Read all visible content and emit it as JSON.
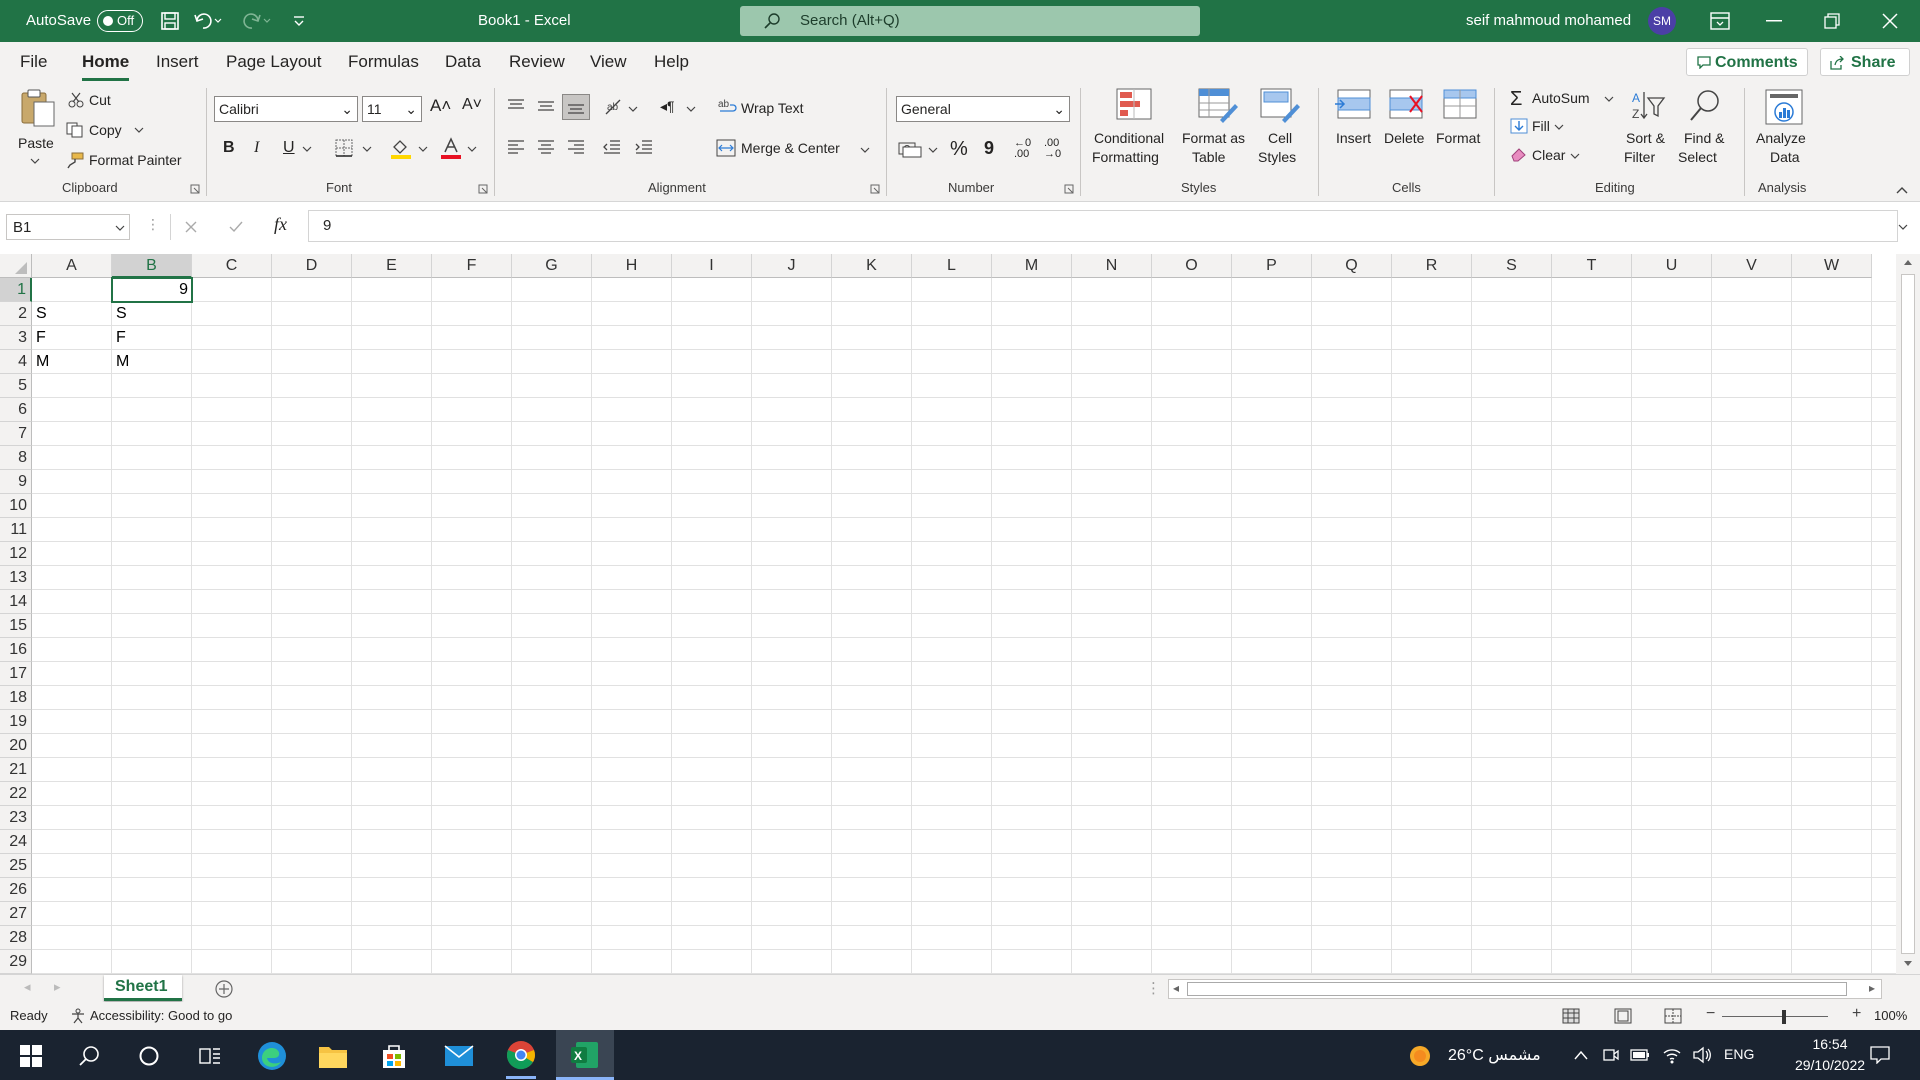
{
  "titlebar": {
    "autosave_label": "AutoSave",
    "autosave_state": "Off",
    "doc_title": "Book1  -  Excel",
    "search_placeholder": "Search (Alt+Q)",
    "user_name": "seif mahmoud mohamed",
    "user_initials": "SM",
    "accent": "#217346"
  },
  "tabs": [
    "File",
    "Home",
    "Insert",
    "Page Layout",
    "Formulas",
    "Data",
    "Review",
    "View",
    "Help"
  ],
  "active_tab": "Home",
  "tab_actions": {
    "comments": "Comments",
    "share": "Share"
  },
  "ribbon": {
    "clipboard": {
      "paste": "Paste",
      "cut": "Cut",
      "copy": "Copy",
      "format_painter": "Format Painter",
      "group": "Clipboard"
    },
    "font": {
      "family": "Calibri",
      "size": "11",
      "bold": "B",
      "italic": "I",
      "underline": "U",
      "group": "Font"
    },
    "alignment": {
      "wrap_text": "Wrap Text",
      "merge_center": "Merge & Center",
      "group": "Alignment"
    },
    "number": {
      "format": "General",
      "percent": "%",
      "comma": "9",
      "group": "Number"
    },
    "styles": {
      "conditional": "Conditional",
      "conditional2": "Formatting",
      "format_as": "Format as",
      "format_as2": "Table",
      "cell": "Cell",
      "cell2": "Styles",
      "group": "Styles"
    },
    "cells": {
      "insert": "Insert",
      "delete": "Delete",
      "format": "Format",
      "group": "Cells"
    },
    "editing": {
      "autosum": "AutoSum",
      "fill": "Fill",
      "clear": "Clear",
      "sort": "Sort &",
      "sort2": "Filter",
      "find": "Find &",
      "find2": "Select",
      "group": "Editing"
    },
    "analysis": {
      "analyze": "Analyze",
      "analyze2": "Data",
      "group": "Analysis"
    }
  },
  "formula_bar": {
    "name_box": "B1",
    "fx": "fx",
    "value": "9"
  },
  "columns": [
    "A",
    "B",
    "C",
    "D",
    "E",
    "F",
    "G",
    "H",
    "I",
    "J",
    "K",
    "L",
    "M",
    "N",
    "O",
    "P",
    "Q",
    "R",
    "S",
    "T",
    "U",
    "V",
    "W"
  ],
  "rows": [
    "1",
    "2",
    "3",
    "4",
    "5",
    "6",
    "7",
    "8",
    "9",
    "10",
    "11",
    "12",
    "13",
    "14",
    "15",
    "16",
    "17",
    "18",
    "19",
    "20",
    "21",
    "22",
    "23",
    "24",
    "25",
    "26",
    "27",
    "28",
    "29"
  ],
  "cells": {
    "B1": "9",
    "A2": "S",
    "B2": "S",
    "A3": "F",
    "B3": "F",
    "A4": "M",
    "B4": "M"
  },
  "sheet_tabs": [
    "Sheet1"
  ],
  "status": {
    "ready": "Ready",
    "accessibility": "Accessibility: Good to go",
    "zoom": "100%"
  },
  "taskbar": {
    "weather": "26°C  مشمس",
    "lang": "ENG",
    "time": "16:54",
    "date": "29/10/2022"
  }
}
